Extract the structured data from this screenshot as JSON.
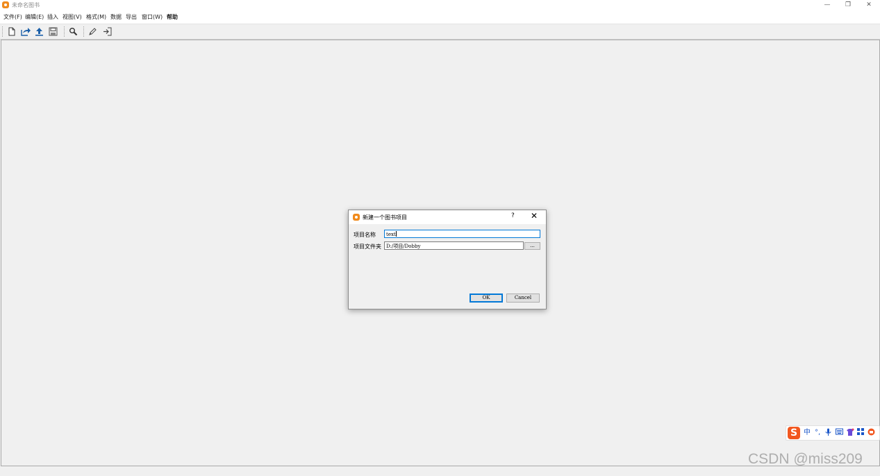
{
  "window": {
    "title": "未命名图书",
    "minimize_glyph": "—",
    "restore_glyph": "❐",
    "close_glyph": "✕"
  },
  "menu": [
    "文件(F)",
    "编辑(E)",
    "插入",
    "视图(V)",
    "格式(M)",
    "数据",
    "导出",
    "窗口(W)",
    "帮助"
  ],
  "toolbar": {
    "buttons": [
      "new-document-icon",
      "share-arrow-icon",
      "upload-arrow-icon",
      "save-icon",
      "search-icon",
      "edit-pencil-icon",
      "login-arrow-icon"
    ]
  },
  "dialog": {
    "title": "新建一个图书项目",
    "help_glyph": "?",
    "close_glyph": "✕",
    "project_name_label": "项目名称",
    "project_name_value": "text",
    "project_folder_label": "项目文件夹",
    "project_folder_value": "D:/项目/Dobby",
    "browse_label": "...",
    "ok_label": "OK",
    "cancel_label": "Cancel"
  },
  "ime_tray": {
    "logo": "S",
    "mode": "中",
    "punct": "°,",
    "items": [
      "mic-icon",
      "keyboard-icon",
      "skin-icon",
      "apps-grid-icon",
      "toolbox-icon"
    ]
  },
  "watermark": "CSDN @miss209",
  "colors": {
    "accent": "#0078d7",
    "app_orange": "#f08a1c",
    "ime_red": "#f2571f"
  }
}
